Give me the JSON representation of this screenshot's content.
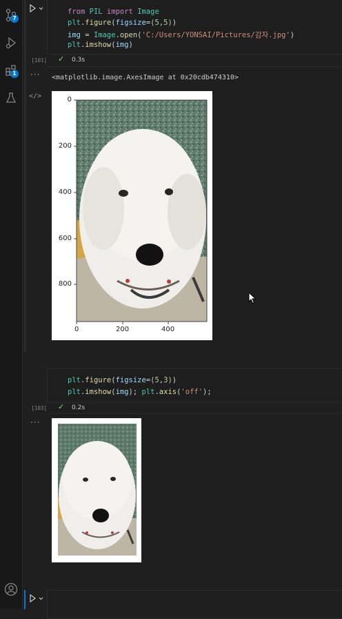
{
  "activity_bar": {
    "source_control_badge": "7",
    "extensions_badge": "1"
  },
  "cell1": {
    "exec_count": "[101]",
    "code": {
      "line1": {
        "kw1": "from",
        "mod": "PIL",
        "kw2": "import",
        "cls": "Image"
      },
      "line2": {
        "obj": "plt",
        "dot": ".",
        "fn": "figure",
        "open": "(",
        "arg": "figsize",
        "eq": "=",
        "val": "(5,5)",
        "close": ")"
      },
      "line3": {
        "var": "img",
        "eq": " = ",
        "cls": "Image",
        "dot": ".",
        "fn": "open",
        "open": "(",
        "str": "'C:/Users/YONSAI/Pictures/감자.jpg'",
        "close": ")"
      },
      "line4": {
        "obj": "plt",
        "dot": ".",
        "fn": "imshow",
        "open": "(",
        "arg": "img",
        "close": ")"
      }
    },
    "status_time": "0.3s",
    "output_text": "<matplotlib.image.AxesImage at 0x20cdb474310>",
    "axes": {
      "y_ticks": [
        "0",
        "200",
        "400",
        "600",
        "800"
      ],
      "x_ticks": [
        "0",
        "200",
        "400"
      ]
    }
  },
  "cell2": {
    "exec_count": "[103]",
    "code": {
      "line1": {
        "obj": "plt",
        "dot": ".",
        "fn": "figure",
        "open": "(",
        "arg": "figsize",
        "eq": "=",
        "val": "(5,3)",
        "close": ")"
      },
      "line2": {
        "obj": "plt",
        "dot": ".",
        "fn": "imshow",
        "open": "(",
        "arg": "img",
        "mid": "); ",
        "obj2": "plt",
        "dot2": ".",
        "fn2": "axis",
        "open2": "(",
        "str": "'off'",
        "close": ");"
      }
    },
    "status_time": "0.2s"
  },
  "colors": {
    "background": "#1f1f1f",
    "accent": "#0078d4",
    "success": "#89d185"
  }
}
